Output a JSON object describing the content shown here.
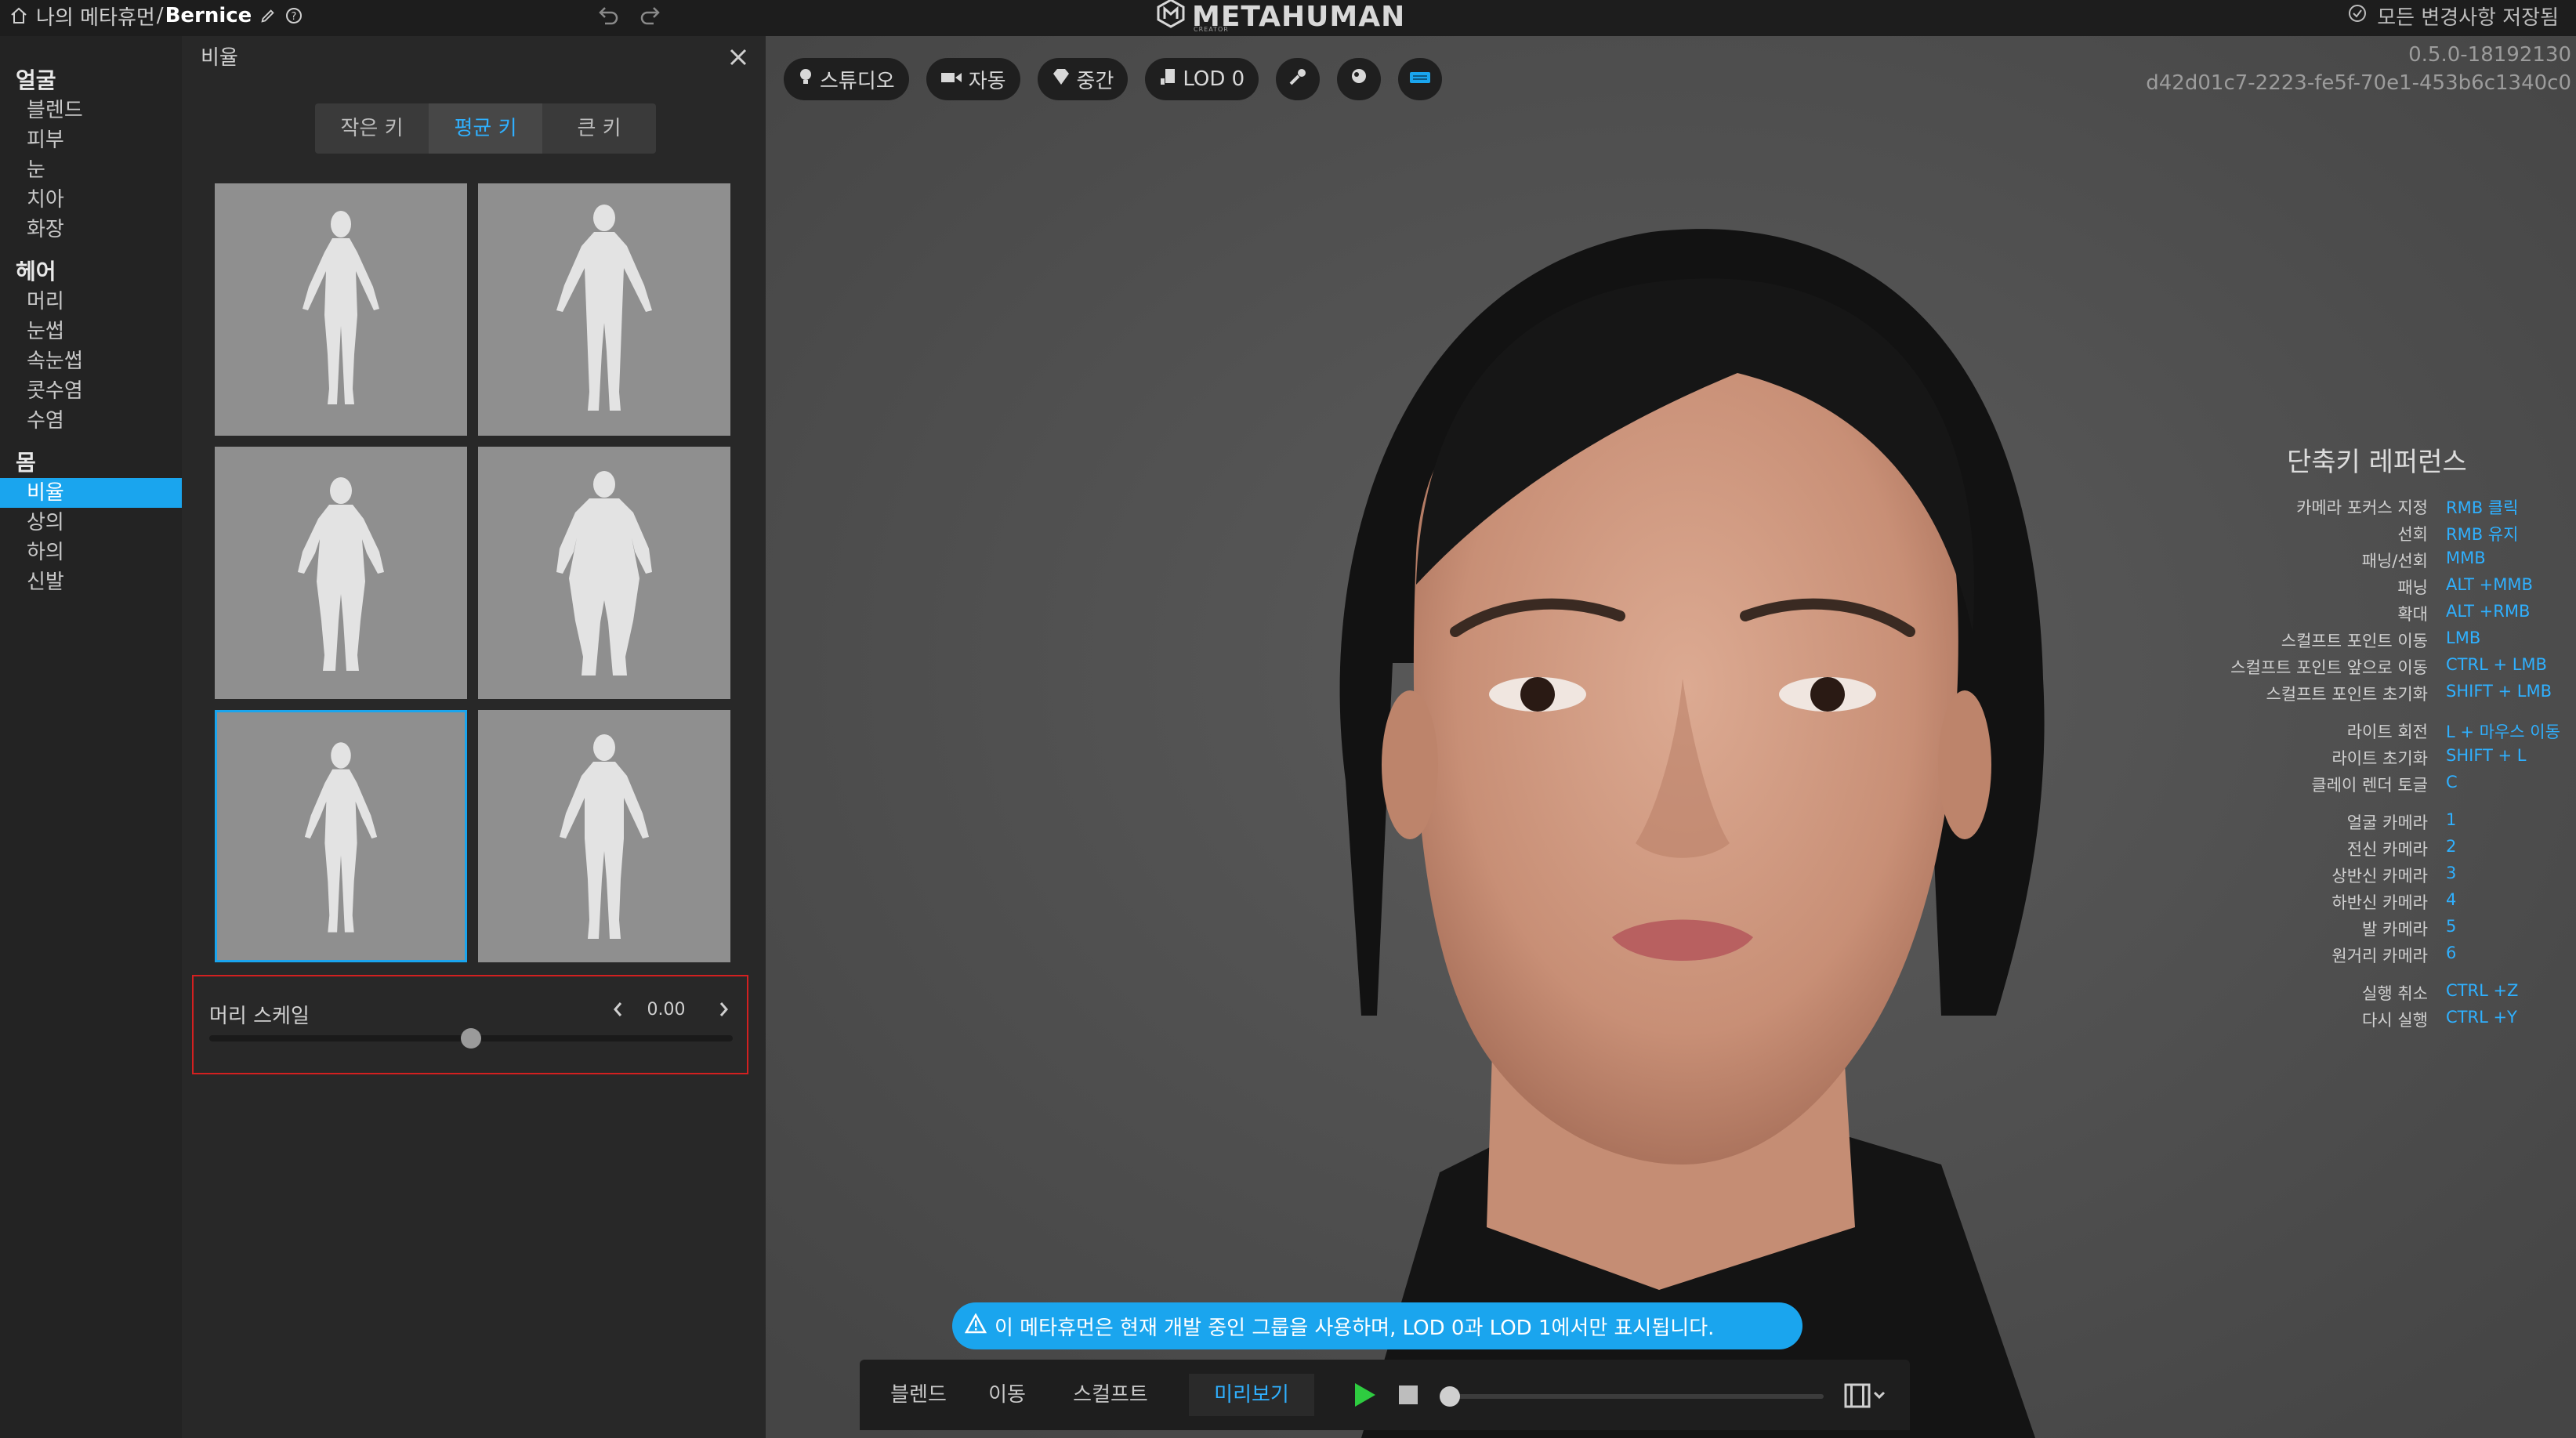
{
  "topbar": {
    "breadcrumb_root": "나의 메타휴먼",
    "breadcrumb_sep": "/",
    "breadcrumb_name": "Bernice",
    "logo": "METAHUMAN",
    "logo_sub": "CREATOR",
    "saved_status": "모든 변경사항 저장됨"
  },
  "nav": {
    "face_group": "얼굴",
    "face_items": [
      "블렌드",
      "피부",
      "눈",
      "치아",
      "화장"
    ],
    "hair_group": "헤어",
    "hair_items": [
      "머리",
      "눈썹",
      "속눈썹",
      "콧수염",
      "수염"
    ],
    "body_group": "몸",
    "body_items": [
      "비율",
      "상의",
      "하의",
      "신발"
    ],
    "active_item": "비율"
  },
  "panel": {
    "title": "비율",
    "height_options": [
      "작은 키",
      "평균 키",
      "큰 키"
    ],
    "selected_height": "평균 키",
    "selected_body_index": 4,
    "slider_label": "머리 스케일",
    "slider_value": "0.00",
    "slider_position": 0.5
  },
  "viewport": {
    "toolbar": {
      "lighting": "스튜디오",
      "camera": "자동",
      "quality": "중간",
      "lod": "LOD 0"
    },
    "version": "0.5.0-18192130",
    "build_id": "d42d01c7-2223-fe5f-70e1-453b6c1340c0",
    "shortcuts": {
      "title": "단축키 레퍼런스",
      "groups": [
        [
          {
            "action": "카메라 포커스 지정",
            "key": "RMB 클릭"
          },
          {
            "action": "선회",
            "key": "RMB 유지"
          },
          {
            "action": "패닝/선회",
            "key": "MMB"
          },
          {
            "action": "패닝",
            "key": "ALT +MMB"
          },
          {
            "action": "확대",
            "key": "ALT +RMB"
          },
          {
            "action": "스컬프트 포인트 이동",
            "key": "LMB"
          },
          {
            "action": "스컬프트 포인트 앞으로 이동",
            "key": "CTRL + LMB"
          },
          {
            "action": "스컬프트 포인트 초기화",
            "key": "SHIFT + LMB"
          }
        ],
        [
          {
            "action": "라이트 회전",
            "key": "L + 마우스 이동"
          },
          {
            "action": "라이트 초기화",
            "key": "SHIFT + L"
          },
          {
            "action": "클레이 렌더 토글",
            "key": "C"
          }
        ],
        [
          {
            "action": "얼굴 카메라",
            "key": "1"
          },
          {
            "action": "전신 카메라",
            "key": "2"
          },
          {
            "action": "상반신 카메라",
            "key": "3"
          },
          {
            "action": "하반신 카메라",
            "key": "4"
          },
          {
            "action": "발 카메라",
            "key": "5"
          },
          {
            "action": "원거리 카메라",
            "key": "6"
          }
        ],
        [
          {
            "action": "실행 취소",
            "key": "CTRL +Z"
          },
          {
            "action": "다시 실행",
            "key": "CTRL +Y"
          }
        ]
      ]
    },
    "notice": "이 메타휴먼은 현재 개발 중인 그룹을 사용하며, LOD 0과 LOD 1에서만 표시됩니다.",
    "modes": [
      "블렌드",
      "이동",
      "스컬프트",
      "미리보기"
    ],
    "active_mode": "미리보기",
    "timeline_position": 0.0,
    "colors": {
      "accent": "#1aa5ee",
      "play": "#2ecc40"
    }
  }
}
